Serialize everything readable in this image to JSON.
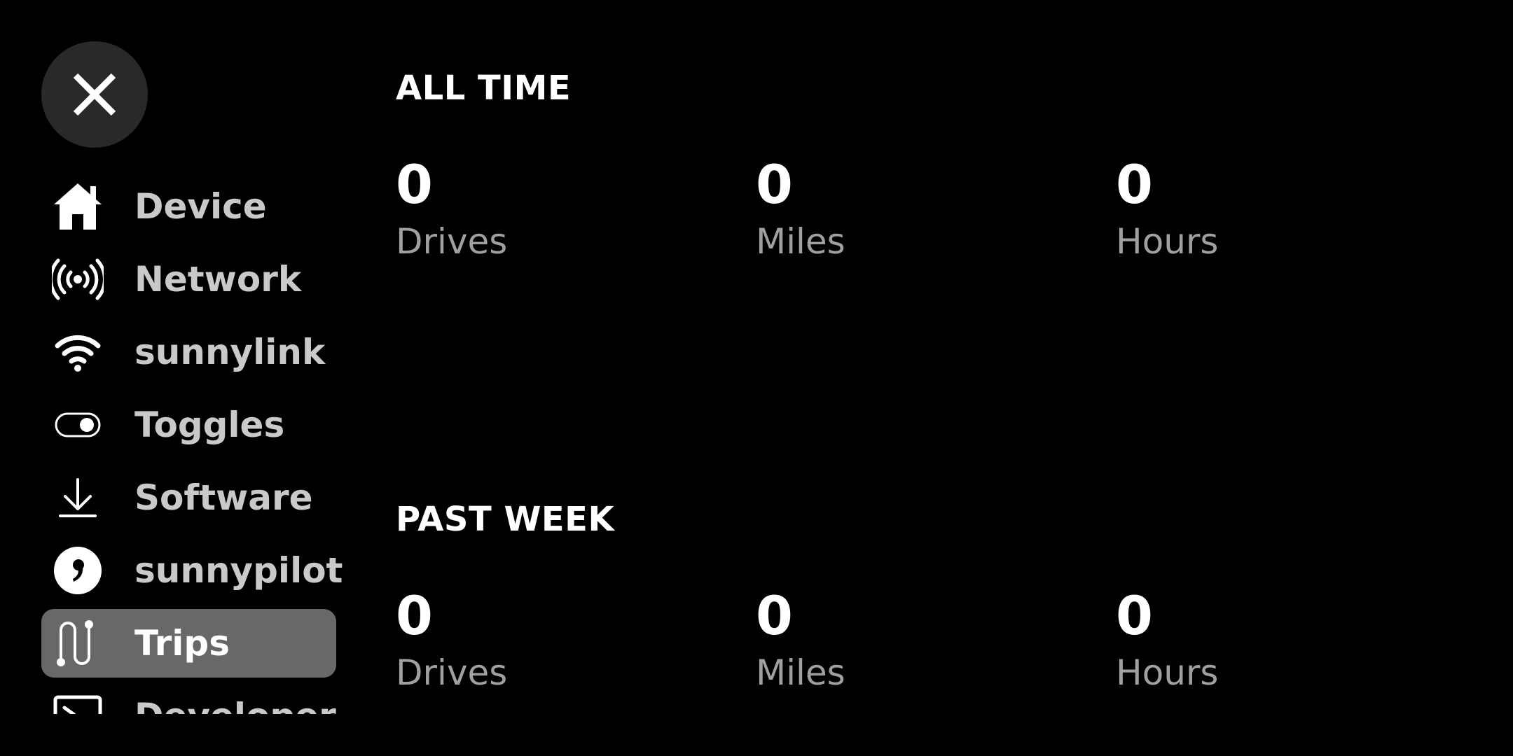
{
  "sidebar": {
    "close_icon": "close-icon",
    "items": [
      {
        "id": "device",
        "label": "Device",
        "icon": "home-icon",
        "active": false
      },
      {
        "id": "network",
        "label": "Network",
        "icon": "broadcast-icon",
        "active": false
      },
      {
        "id": "sunnylink",
        "label": "sunnylink",
        "icon": "wifi-icon",
        "active": false
      },
      {
        "id": "toggles",
        "label": "Toggles",
        "icon": "toggle-icon",
        "active": false
      },
      {
        "id": "software",
        "label": "Software",
        "icon": "download-icon",
        "active": false
      },
      {
        "id": "sunnypilot",
        "label": "sunnypilot",
        "icon": "sunnypilot-logo-icon",
        "active": false
      },
      {
        "id": "trips",
        "label": "Trips",
        "icon": "route-icon",
        "active": true
      },
      {
        "id": "developer",
        "label": "Developer",
        "icon": "terminal-icon",
        "active": false
      }
    ]
  },
  "all_time": {
    "title": "ALL TIME",
    "stats": [
      {
        "value": "0",
        "unit": "Drives"
      },
      {
        "value": "0",
        "unit": "Miles"
      },
      {
        "value": "0",
        "unit": "Hours"
      }
    ]
  },
  "past_week": {
    "title": "PAST WEEK",
    "stats": [
      {
        "value": "0",
        "unit": "Drives"
      },
      {
        "value": "0",
        "unit": "Miles"
      },
      {
        "value": "0",
        "unit": "Hours"
      }
    ]
  },
  "colors": {
    "background": "#000000",
    "close_button": "#292929",
    "active_item": "#686868",
    "nav_text": "#c9c9c9",
    "unit_text": "#a0a0a0"
  }
}
